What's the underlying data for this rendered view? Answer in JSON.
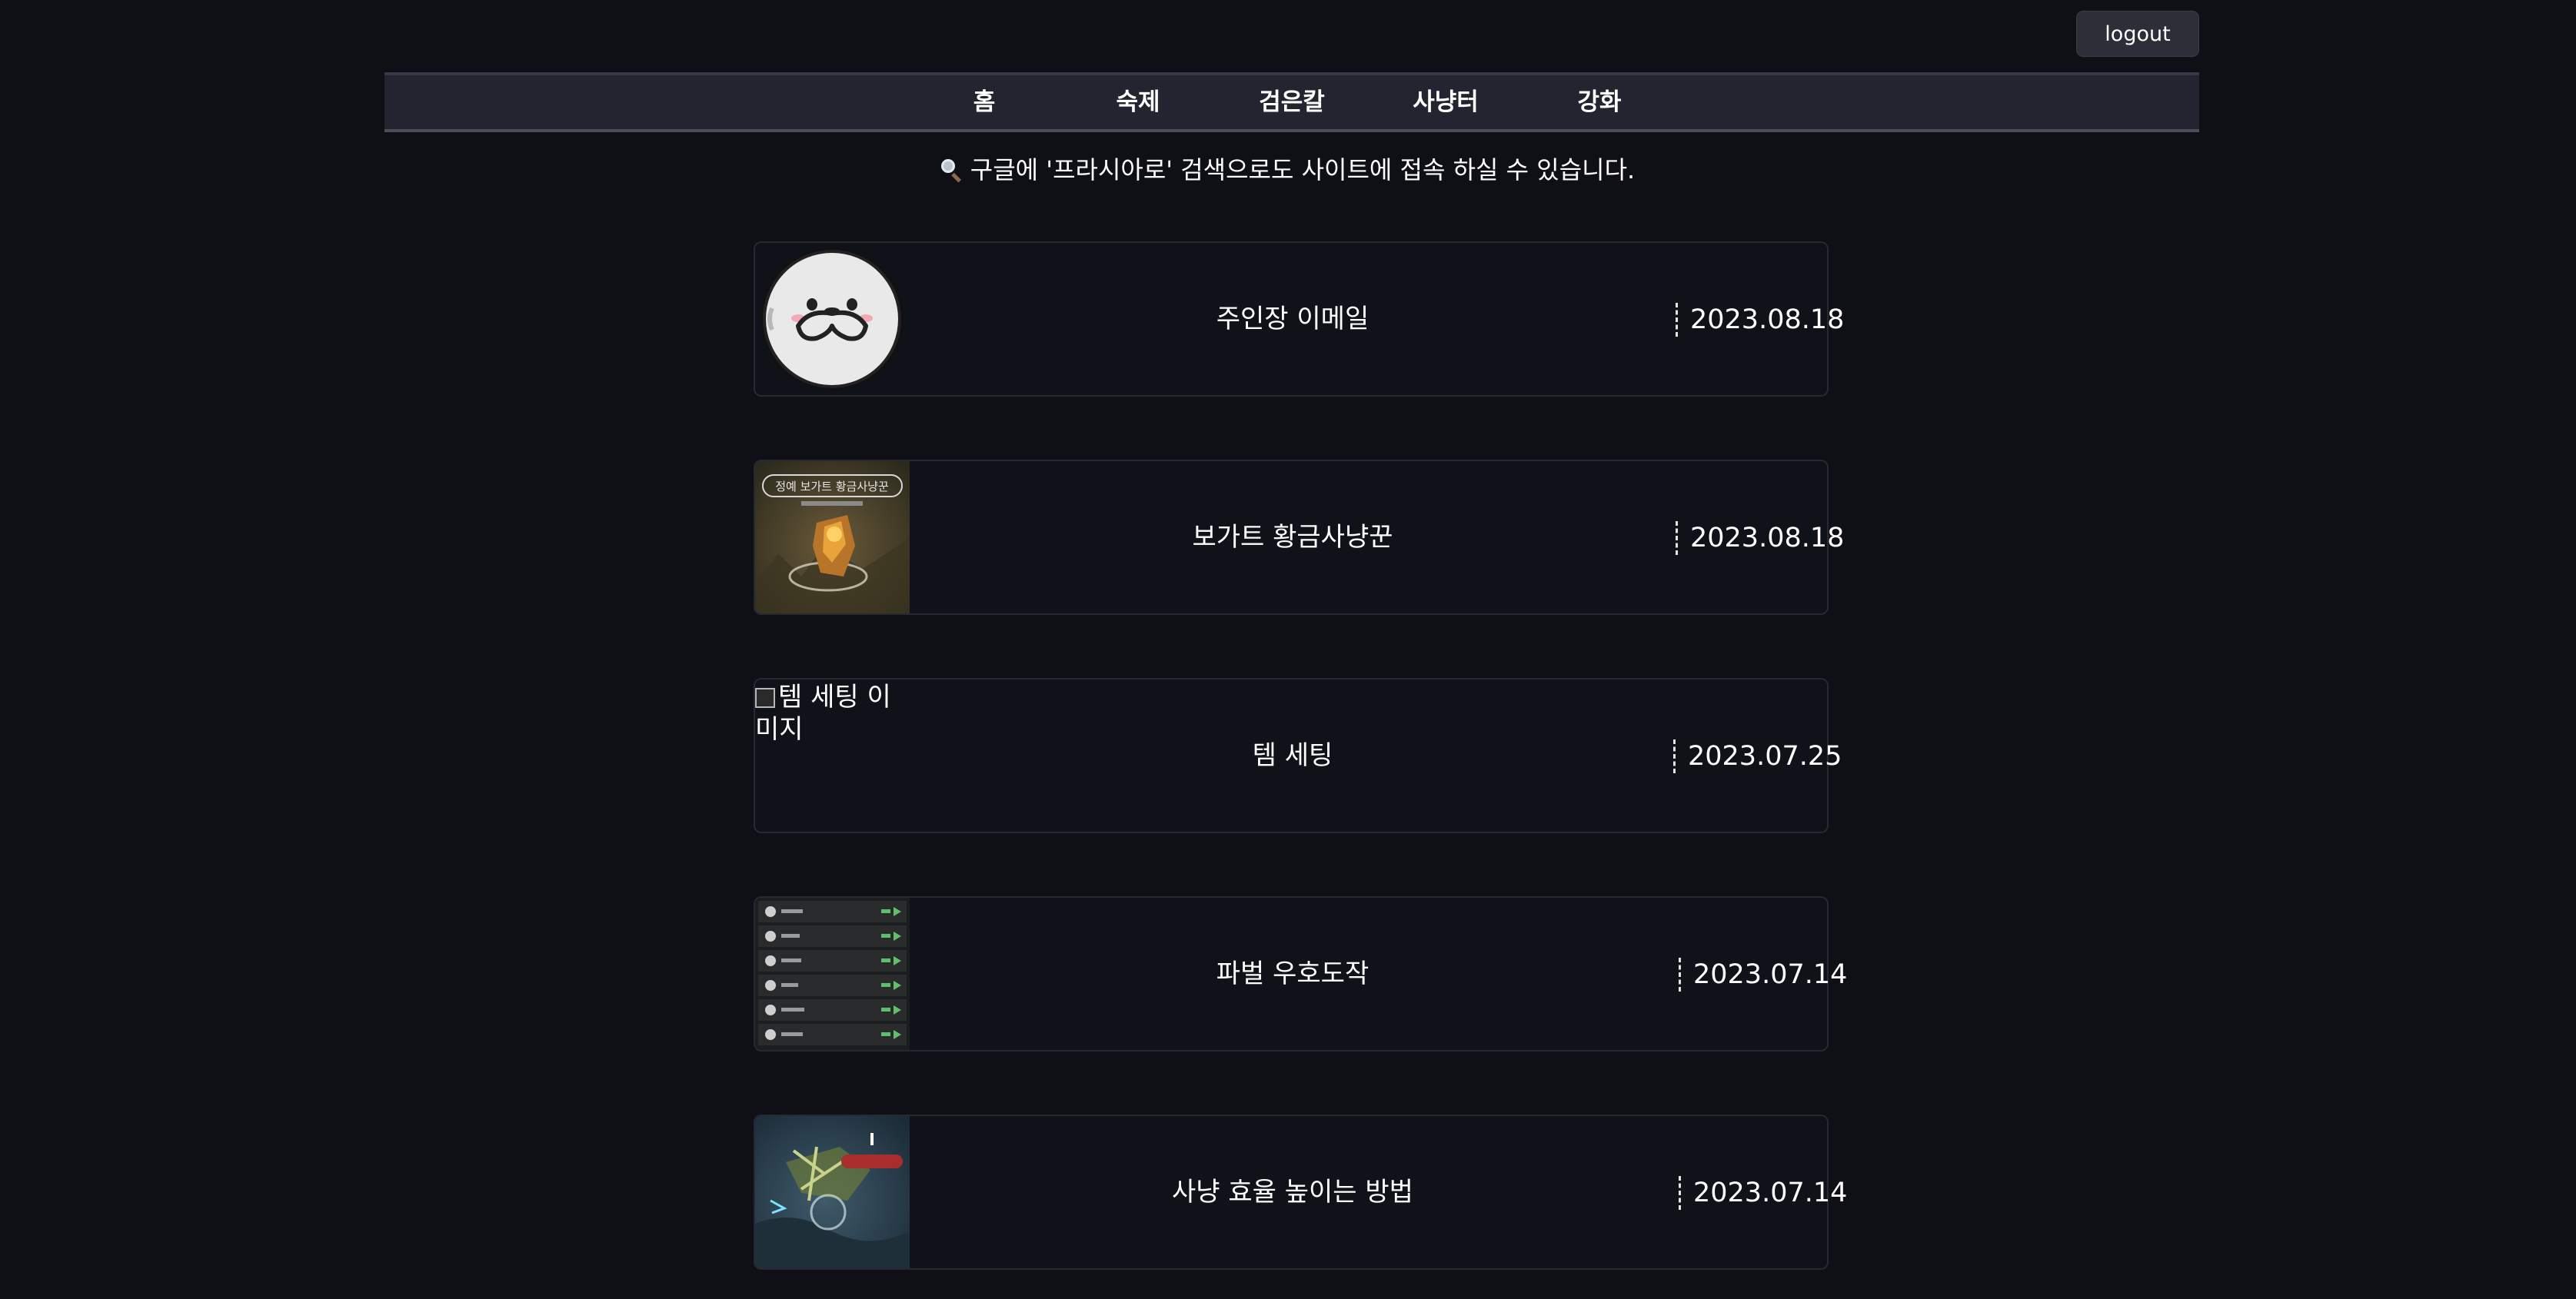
{
  "header": {
    "logout_label": "logout"
  },
  "nav": {
    "items": [
      {
        "label": "홈"
      },
      {
        "label": "숙제"
      },
      {
        "label": "검은칼"
      },
      {
        "label": "사냥터"
      },
      {
        "label": "강화"
      }
    ]
  },
  "notice": {
    "icon": "magnifier-icon",
    "text": "구글에 '프라시아로' 검색으로도 사이트에 접속 하실 수 있습니다."
  },
  "posts": [
    {
      "title": "주인장 이메일",
      "date": "2023.08.18",
      "thumbnail": "smiling-mascot-avatar"
    },
    {
      "title": "보가트 황금사냥꾼",
      "date": "2023.08.18",
      "thumbnail": "game-scene-hunter",
      "thumbnail_caption": "정예 보가트 황금사냥꾼"
    },
    {
      "title": "템 세팅",
      "date": "2023.07.25",
      "thumbnail": "broken-image",
      "thumbnail_alt": "템 세팅 이미지"
    },
    {
      "title": "파벌 우호도작",
      "date": "2023.07.14",
      "thumbnail": "faction-list-screenshot"
    },
    {
      "title": "사냥 효율 높이는 방법",
      "date": "2023.07.14",
      "thumbnail": "game-scene-battle"
    }
  ],
  "colors": {
    "background": "#0f1016",
    "nav_background": "#22242f",
    "card_border": "#262833",
    "button_background": "#2d2f38"
  }
}
